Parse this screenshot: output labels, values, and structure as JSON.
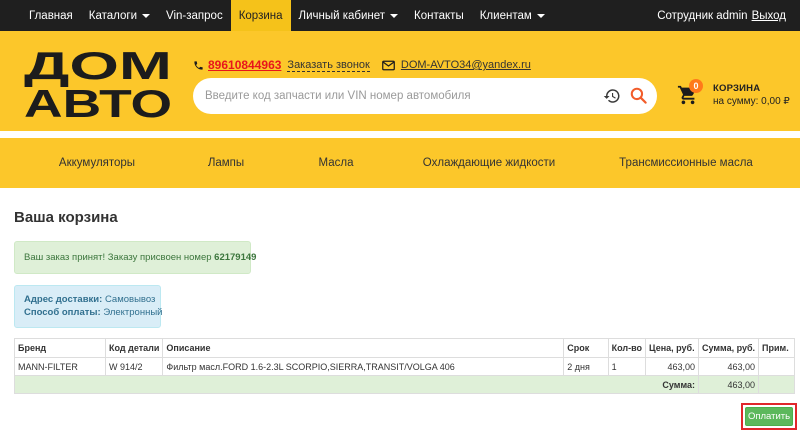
{
  "nav": {
    "items": [
      {
        "label": "Главная",
        "dropdown": false,
        "active": false
      },
      {
        "label": "Каталоги",
        "dropdown": true,
        "active": false
      },
      {
        "label": "Vin-запрос",
        "dropdown": false,
        "active": false
      },
      {
        "label": "Корзина",
        "dropdown": false,
        "active": true
      },
      {
        "label": "Личный кабинет",
        "dropdown": true,
        "active": false
      },
      {
        "label": "Контакты",
        "dropdown": false,
        "active": false
      },
      {
        "label": "Клиентам",
        "dropdown": true,
        "active": false
      }
    ],
    "user_label": "Сотрудник admin",
    "logout_label": "Выход"
  },
  "header": {
    "logo_text_top": "ДОМ",
    "logo_text_bottom": "АВТО",
    "phone": "89610844963",
    "callback_label": "Заказать звонок",
    "email": "DOM-AVTO34@yandex.ru",
    "search_placeholder": "Введите код запчасти или VIN номер автомобиля",
    "cart_count": "0",
    "cart_title": "КОРЗИНА",
    "cart_sum": "на сумму: 0,00 ₽"
  },
  "categories": [
    "Аккумуляторы",
    "Лампы",
    "Масла",
    "Охлаждающие жидкости",
    "Трансмиссионные масла"
  ],
  "content": {
    "title": "Ваша корзина",
    "order_message": "Ваш заказ принят! Заказу присвоен номер",
    "order_number": "62179149",
    "delivery_label": "Адрес доставки:",
    "delivery_value": "Самовывоз",
    "payment_label": "Способ оплаты:",
    "payment_value": "Электронный"
  },
  "table": {
    "headers": [
      "Бренд",
      "Код детали",
      "Описание",
      "Срок",
      "Кол-во",
      "Цена, руб.",
      "Сумма, руб.",
      "Прим."
    ],
    "rows": [
      [
        "MANN-FILTER",
        "W 914/2",
        "Фильтр масл.FORD 1.6-2.3L SCORPIO,SIERRA,TRANSIT/VOLGA 406",
        "2 дня",
        "1",
        "463,00",
        "463,00",
        ""
      ]
    ],
    "total_label": "Сумма:",
    "total_value": "463,00"
  },
  "pay_label": "Оплатить",
  "colors": {
    "nav_bg": "#1f1f1f",
    "brand_yellow": "#fcc72a",
    "phone_red": "#e8161b",
    "badge_orange": "#ff7a1a",
    "success_bg": "#dff0d8",
    "info_bg": "#d9edf7",
    "pay_green": "#5cb85c",
    "highlight_red": "#e0262b"
  }
}
